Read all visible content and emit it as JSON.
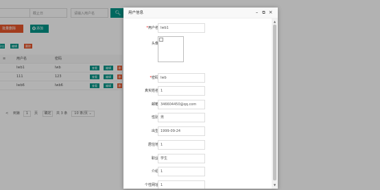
{
  "search": {
    "field1": "日",
    "field2": "截止日",
    "field3": "请输入用户名",
    "search_icon": "search-icon"
  },
  "actions": {
    "batch_delete": "批量删除",
    "add": "添加"
  },
  "mini_buttons": [
    "导出",
    "编辑",
    "删除"
  ],
  "table": {
    "headers": [
      "",
      "用户名",
      "密码"
    ],
    "rows": [
      {
        "no": "",
        "username": "lwb1",
        "password": "lwb"
      },
      {
        "no": "",
        "username": "111",
        "password": "123"
      },
      {
        "no": "",
        "username": "lwb6",
        "password": "lwb6"
      }
    ],
    "op_labels": [
      "查看",
      "编辑",
      "删除"
    ]
  },
  "pager": {
    "prev": "<",
    "goto": "到第",
    "page": "1",
    "page_unit": "页",
    "confirm": "确定",
    "total": "共 3 条",
    "per_page": "10 条/页"
  },
  "dialog": {
    "title": "用户信息",
    "fields": [
      {
        "label": "用户名",
        "required": true,
        "value": "lwb1"
      },
      {
        "label": "头像",
        "required": false,
        "value": ""
      },
      {
        "label": "密码",
        "required": true,
        "value": "lwb"
      },
      {
        "label": "真实姓名",
        "required": false,
        "value": "1"
      },
      {
        "label": "邮箱",
        "required": false,
        "value": "346604450@qq.com"
      },
      {
        "label": "性别",
        "required": false,
        "value": "男"
      },
      {
        "label": "出生",
        "required": false,
        "value": "1999-09-24"
      },
      {
        "label": "居住地",
        "required": false,
        "value": "1"
      },
      {
        "label": "职业",
        "required": false,
        "value": "学生"
      },
      {
        "label": "介绍",
        "required": false,
        "value": "1"
      },
      {
        "label": "个性网址",
        "required": false,
        "value": "1"
      }
    ]
  },
  "colors": {
    "primary": "#009688",
    "danger": "#e8572c",
    "warn": "#ff5722"
  }
}
